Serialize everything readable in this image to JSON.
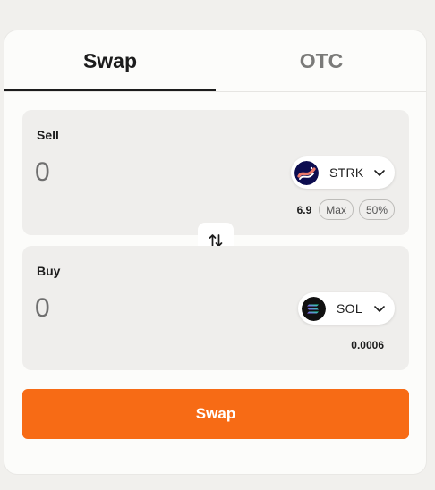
{
  "tabs": [
    {
      "label": "Swap",
      "active": true
    },
    {
      "label": "OTC",
      "active": false
    }
  ],
  "sell": {
    "label": "Sell",
    "amount_placeholder": "0",
    "token": {
      "symbol": "STRK",
      "icon": "starknet-logo-icon"
    },
    "balance": "6.9",
    "max_label": "Max",
    "half_label": "50%"
  },
  "buy": {
    "label": "Buy",
    "amount_placeholder": "0",
    "token": {
      "symbol": "SOL",
      "icon": "solana-logo-icon"
    },
    "quote": "0.0006"
  },
  "swap_direction_icon": "swap-vertical-arrows-icon",
  "submit_label": "Swap",
  "colors": {
    "accent": "#f76b15",
    "panel": "#efeeec",
    "card": "#fcfcfa",
    "page": "#f1f0ed"
  }
}
